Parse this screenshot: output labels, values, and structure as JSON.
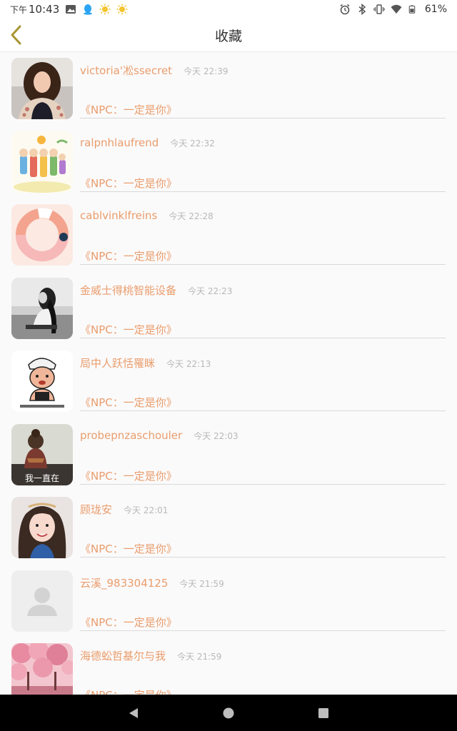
{
  "status_bar": {
    "time_prefix": "下午",
    "time": "10:43",
    "battery": "61%",
    "icons": [
      "image-icon",
      "qq-icon",
      "weather-sun-icon",
      "weather-sun-icon",
      "alarm-icon",
      "bluetooth-icon",
      "vibrate-icon",
      "wifi-icon",
      "battery-icon"
    ]
  },
  "header": {
    "title": "收藏",
    "back_icon": "chevron-left-icon",
    "accent": "#a89530"
  },
  "favorites": [
    {
      "name": "victoria'凇ssecret",
      "time": "今天 22:39",
      "desc": "《NPC：一定是你》",
      "avatar": "woman-portrait"
    },
    {
      "name": "ralpnhlaufrend",
      "time": "今天 22:32",
      "desc": "《NPC：一定是你》",
      "avatar": "cartoon-family"
    },
    {
      "name": "cablvinklfreins",
      "time": "今天 22:28",
      "desc": "《NPC：一定是你》",
      "avatar": "donut-ring"
    },
    {
      "name": "金威士得桃智能设备",
      "time": "今天 22:23",
      "desc": "《NPC：一定是你》",
      "avatar": "bw-girl"
    },
    {
      "name": "局中人跃恬罹眯",
      "time": "今天 22:13",
      "desc": "《NPC：一定是你》",
      "avatar": "cartoon-meme"
    },
    {
      "name": "probepnzaschouler",
      "time": "今天 22:03",
      "desc": "《NPC：一定是你》",
      "avatar": "girl-back-text",
      "avatar_caption": "我一直在"
    },
    {
      "name": "顾珑安",
      "time": "今天 22:01",
      "desc": "《NPC：一定是你》",
      "avatar": "girl-smile"
    },
    {
      "name": "云溪_983304125",
      "time": "今天 21:59",
      "desc": "《NPC：一定是你》",
      "avatar": "default-user"
    },
    {
      "name": "海德蚣哲基尔与我",
      "time": "今天 21:59",
      "desc": "《NPC：一定是你》",
      "avatar": "pink-trees"
    }
  ],
  "colors": {
    "name": "#e99d6c",
    "time": "#b8b8b8",
    "divider": "#d9d9d9",
    "background": "#fbfafb"
  },
  "nav_bar": {
    "back_icon": "triangle-back-icon",
    "home_icon": "circle-home-icon",
    "recents_icon": "square-recents-icon"
  }
}
